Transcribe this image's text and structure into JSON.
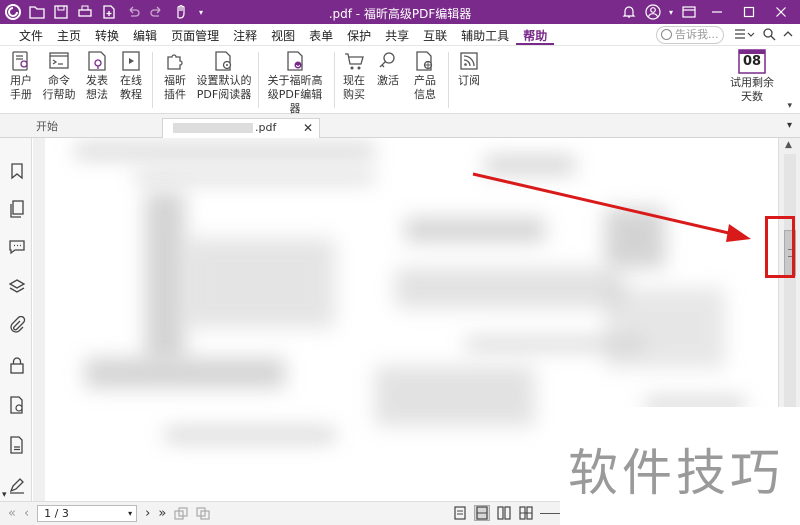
{
  "window": {
    "title": ".pdf - 福昕高级PDF编辑器"
  },
  "menu": {
    "items": [
      "文件",
      "主页",
      "转换",
      "编辑",
      "页面管理",
      "注释",
      "视图",
      "表单",
      "保护",
      "共享",
      "互联",
      "辅助工具",
      "帮助"
    ],
    "active": "帮助",
    "search_placeholder": "告诉我..."
  },
  "ribbon": {
    "user_manual": [
      "用户",
      "手册"
    ],
    "command_help": [
      "命令",
      "行帮助"
    ],
    "feedback": [
      "发表",
      "想法"
    ],
    "tutorial": [
      "在线",
      "教程"
    ],
    "plugins": [
      "福昕",
      "插件"
    ],
    "default_reader": [
      "设置默认的",
      "PDF阅读器"
    ],
    "about": [
      "关于福昕高",
      "级PDF编辑器"
    ],
    "buy_now": [
      "现在",
      "购买"
    ],
    "activate": [
      "激活"
    ],
    "product_info": [
      "产品",
      "信息"
    ],
    "subscribe": [
      "订阅"
    ],
    "trial": {
      "days": "08",
      "label": [
        "试用剩余",
        "天数"
      ]
    }
  },
  "tabs": {
    "start": "开始",
    "document": ".pdf"
  },
  "status": {
    "page": "1 / 3"
  },
  "watermark": "软件技巧",
  "colors": {
    "brand": "#7a2a8a",
    "annotation": "#d91a1a"
  }
}
